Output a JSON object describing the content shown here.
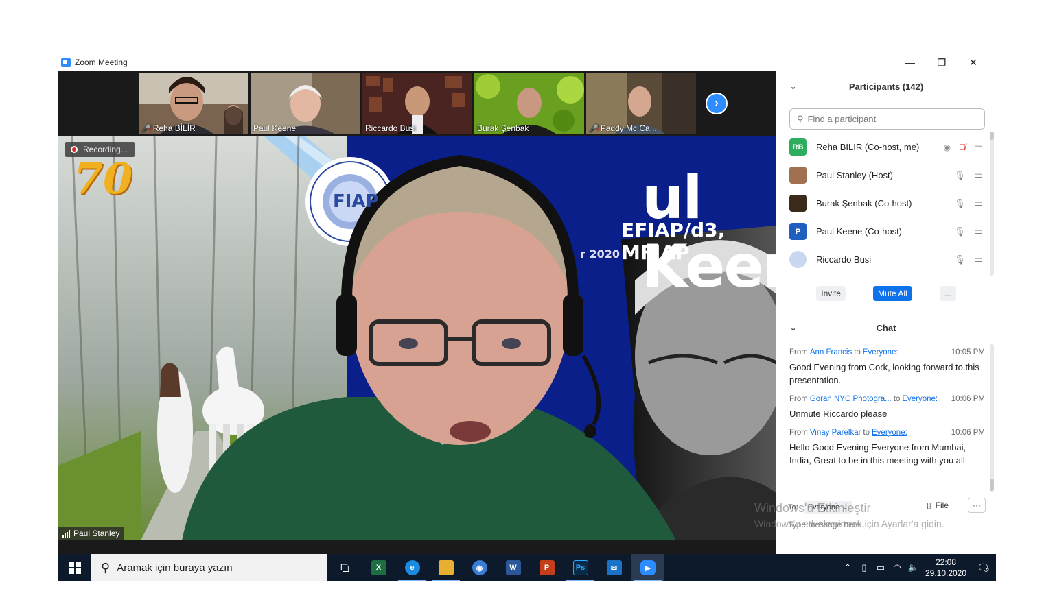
{
  "window": {
    "title": "Zoom Meeting",
    "controls": [
      "minimize-icon",
      "restore-icon",
      "close-icon"
    ]
  },
  "thumbnails": [
    {
      "name": "Reha BİLİR",
      "muted": true,
      "bg": "#7a6450"
    },
    {
      "name": "Paul Keene",
      "muted": false,
      "bg": "#8c8372"
    },
    {
      "name": "Riccardo Busi",
      "muted": false,
      "bg": "#5a2c28"
    },
    {
      "name": "Burak Şenbak",
      "muted": false,
      "bg": "#5f9a1a"
    },
    {
      "name": "Paddy Mc Ca...",
      "muted": true,
      "bg": "#5a4a3a"
    }
  ],
  "main_video": {
    "recording_label": "Recording...",
    "speaker_name": "Paul Stanley",
    "slide_title": "ul Keene",
    "slide_subtitle": "EFIAP/d3, MFIAP",
    "slide_date": "r 2020",
    "logo_text": "70",
    "fiap_text": "FIAP"
  },
  "participants": {
    "header": "Participants (142)",
    "search_placeholder": "Find a participant",
    "list": [
      {
        "name": "Reha BİLİR (Co-host, me)",
        "avatar_text": "RB",
        "avatar_color": "#2ead5f",
        "recording": true,
        "mic": "muted",
        "video": "camera-icon"
      },
      {
        "name": "Paul Stanley (Host)",
        "avatar_text": "",
        "avatar_color": "#a07050",
        "recording": false,
        "mic": "mic-icon",
        "video": "camera-icon"
      },
      {
        "name": "Burak Şenbak (Co-host)",
        "avatar_text": "",
        "avatar_color": "#3a2a1a",
        "recording": false,
        "mic": "mic-icon",
        "video": "camera-icon"
      },
      {
        "name": "Paul Keene (Co-host)",
        "avatar_text": "P",
        "avatar_color": "#1f5fbf",
        "recording": false,
        "mic": "mic-icon",
        "video": "camera-icon"
      },
      {
        "name": "Riccardo Busi",
        "avatar_text": "",
        "avatar_color": "#c8d8f0",
        "recording": false,
        "mic": "mic-icon",
        "video": "camera-icon"
      }
    ],
    "buttons": {
      "invite": "Invite",
      "mute_all": "Mute All",
      "more": "..."
    }
  },
  "chat": {
    "header": "Chat",
    "messages": [
      {
        "prefix": "From",
        "sender": "Ann Francis",
        "to_word": "to",
        "recipient": "Everyone:",
        "time": "10:05 PM",
        "text": "Good Evening from Cork, looking forward to this presentation."
      },
      {
        "prefix": "From",
        "sender": "Goran NYC Photogra...",
        "to_word": "to",
        "recipient": "Everyone:",
        "time": "10:06 PM",
        "text": "Unmute Riccardo please"
      },
      {
        "prefix": "From",
        "sender": "Vinay Parelkar",
        "to_word": "to",
        "recipient": "Everyone:",
        "time": "10:06 PM",
        "text": "Hello Good Evening Everyone from Mumbai, India, Great to be in this meeting with you all"
      }
    ],
    "to_label": "To:",
    "to_value": "Everyone",
    "file_label": "File",
    "more_label": "···",
    "input_placeholder": "Type message here..."
  },
  "watermark": {
    "line1": "Windows'u Etkinleştir",
    "line2": "Windows'u etkinleştirmek için Ayarlar'a gidin."
  },
  "taskbar": {
    "search_text": "Aramak için buraya yazın",
    "apps": [
      {
        "name": "task-view",
        "glyph": "⧉",
        "color": "transparent"
      },
      {
        "name": "excel",
        "glyph": "X",
        "color": "#1d6f42"
      },
      {
        "name": "edge",
        "glyph": "e",
        "color": "#1a8be0"
      },
      {
        "name": "file-explorer",
        "glyph": "▬",
        "color": "#e8b030"
      },
      {
        "name": "chrome-like",
        "glyph": "◉",
        "color": "#3a7bd5"
      },
      {
        "name": "word",
        "glyph": "W",
        "color": "#2b579a"
      },
      {
        "name": "powerpoint",
        "glyph": "P",
        "color": "#c43e1c"
      },
      {
        "name": "photoshop",
        "glyph": "Ps",
        "color": "#0a2a4a"
      },
      {
        "name": "mail",
        "glyph": "✉",
        "color": "#1a73c8"
      },
      {
        "name": "zoom",
        "glyph": "▶",
        "color": "#2d8cff"
      }
    ],
    "time": "22:08",
    "date": "29.10.2020",
    "notification_count": "2"
  }
}
